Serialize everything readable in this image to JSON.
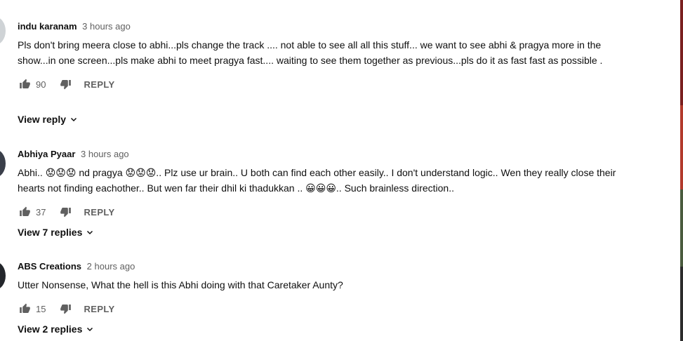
{
  "comments": [
    {
      "author": "indu karanam",
      "time": "3 hours ago",
      "text": "Pls don't bring meera close to abhi...pls change the track .... not able to see all all this stuff... we want to see abhi & pragya more in the show...in one screen...pls make abhi to meet pragya fast.... waiting to see them together as previous...pls do it as fast fast as possible .",
      "likes": "90",
      "reply_label": "REPLY",
      "view_replies": "View reply"
    },
    {
      "author": "Abhiya Pyaar",
      "time": "3 hours ago",
      "text": "Abhi.. 😟😟😟 nd pragya 😟😟😟.. Plz use ur brain..  U both can find each other easily.. I don't understand logic..  Wen they really close their hearts not finding eachother.. But wen far their dhil ki thadukkan .. 😀😀😀.. Such brainless direction..",
      "likes": "37",
      "reply_label": "REPLY",
      "view_replies": "View 7 replies"
    },
    {
      "author": "ABS Creations",
      "time": "2 hours ago",
      "text": "Utter Nonsense, What the hell is this Abhi doing with that Caretaker Aunty?",
      "likes": "15",
      "reply_label": "REPLY",
      "view_replies": "View 2 replies"
    }
  ],
  "icons": {
    "like": "thumbs-up-icon",
    "dislike": "thumbs-down-icon",
    "expand": "chevron-down-icon"
  },
  "colors": {
    "text": "#0f0f0f",
    "secondary": "#606060"
  }
}
